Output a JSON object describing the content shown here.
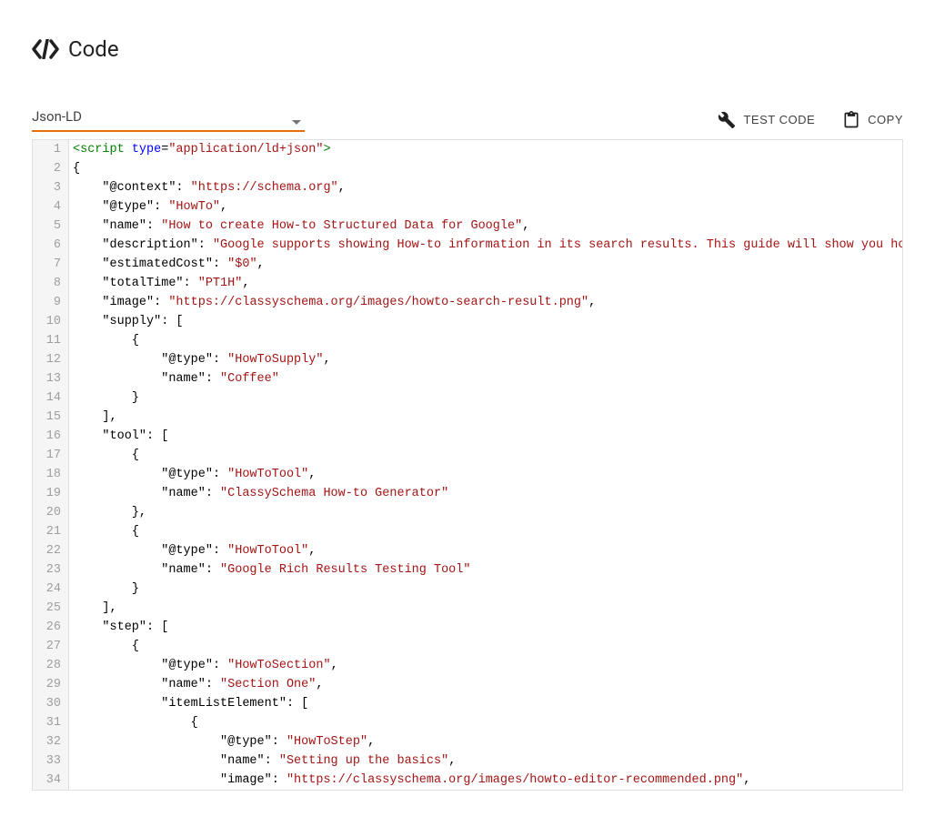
{
  "header": {
    "title": "Code"
  },
  "toolbar": {
    "dropdown_label": "Json-LD",
    "test_label": "TEST CODE",
    "copy_label": "COPY"
  },
  "editor": {
    "lines": [
      {
        "n": 1,
        "tokens": [
          [
            "t-tag",
            "<script "
          ],
          [
            "t-attr",
            "type"
          ],
          [
            "t-punct",
            "="
          ],
          [
            "t-str",
            "\"application/ld+json\""
          ],
          [
            "t-tag",
            ">"
          ]
        ]
      },
      {
        "n": 2,
        "tokens": [
          [
            "t-punct",
            "{"
          ]
        ]
      },
      {
        "n": 3,
        "tokens": [
          [
            "",
            "    "
          ],
          [
            "t-key",
            "\"@context\""
          ],
          [
            "t-punct",
            ": "
          ],
          [
            "t-str",
            "\"https://schema.org\""
          ],
          [
            "t-punct",
            ","
          ]
        ]
      },
      {
        "n": 4,
        "tokens": [
          [
            "",
            "    "
          ],
          [
            "t-key",
            "\"@type\""
          ],
          [
            "t-punct",
            ": "
          ],
          [
            "t-str",
            "\"HowTo\""
          ],
          [
            "t-punct",
            ","
          ]
        ]
      },
      {
        "n": 5,
        "tokens": [
          [
            "",
            "    "
          ],
          [
            "t-key",
            "\"name\""
          ],
          [
            "t-punct",
            ": "
          ],
          [
            "t-str",
            "\"How to create How-to Structured Data for Google\""
          ],
          [
            "t-punct",
            ","
          ]
        ]
      },
      {
        "n": 6,
        "tokens": [
          [
            "",
            "    "
          ],
          [
            "t-key",
            "\"description\""
          ],
          [
            "t-punct",
            ": "
          ],
          [
            "t-str",
            "\"Google supports showing How-to information in its search results. This guide will show you how to use "
          ]
        ]
      },
      {
        "n": 7,
        "tokens": [
          [
            "",
            "    "
          ],
          [
            "t-key",
            "\"estimatedCost\""
          ],
          [
            "t-punct",
            ": "
          ],
          [
            "t-str",
            "\"$0\""
          ],
          [
            "t-punct",
            ","
          ]
        ]
      },
      {
        "n": 8,
        "tokens": [
          [
            "",
            "    "
          ],
          [
            "t-key",
            "\"totalTime\""
          ],
          [
            "t-punct",
            ": "
          ],
          [
            "t-str",
            "\"PT1H\""
          ],
          [
            "t-punct",
            ","
          ]
        ]
      },
      {
        "n": 9,
        "tokens": [
          [
            "",
            "    "
          ],
          [
            "t-key",
            "\"image\""
          ],
          [
            "t-punct",
            ": "
          ],
          [
            "t-str",
            "\"https://classyschema.org/images/howto-search-result.png\""
          ],
          [
            "t-punct",
            ","
          ]
        ]
      },
      {
        "n": 10,
        "tokens": [
          [
            "",
            "    "
          ],
          [
            "t-key",
            "\"supply\""
          ],
          [
            "t-punct",
            ": ["
          ]
        ]
      },
      {
        "n": 11,
        "tokens": [
          [
            "",
            "        "
          ],
          [
            "t-punct",
            "{"
          ]
        ]
      },
      {
        "n": 12,
        "tokens": [
          [
            "",
            "            "
          ],
          [
            "t-key",
            "\"@type\""
          ],
          [
            "t-punct",
            ": "
          ],
          [
            "t-str",
            "\"HowToSupply\""
          ],
          [
            "t-punct",
            ","
          ]
        ]
      },
      {
        "n": 13,
        "tokens": [
          [
            "",
            "            "
          ],
          [
            "t-key",
            "\"name\""
          ],
          [
            "t-punct",
            ": "
          ],
          [
            "t-str",
            "\"Coffee\""
          ]
        ]
      },
      {
        "n": 14,
        "tokens": [
          [
            "",
            "        "
          ],
          [
            "t-punct",
            "}"
          ]
        ]
      },
      {
        "n": 15,
        "tokens": [
          [
            "",
            "    "
          ],
          [
            "t-punct",
            "],"
          ]
        ]
      },
      {
        "n": 16,
        "tokens": [
          [
            "",
            "    "
          ],
          [
            "t-key",
            "\"tool\""
          ],
          [
            "t-punct",
            ": ["
          ]
        ]
      },
      {
        "n": 17,
        "tokens": [
          [
            "",
            "        "
          ],
          [
            "t-punct",
            "{"
          ]
        ]
      },
      {
        "n": 18,
        "tokens": [
          [
            "",
            "            "
          ],
          [
            "t-key",
            "\"@type\""
          ],
          [
            "t-punct",
            ": "
          ],
          [
            "t-str",
            "\"HowToTool\""
          ],
          [
            "t-punct",
            ","
          ]
        ]
      },
      {
        "n": 19,
        "tokens": [
          [
            "",
            "            "
          ],
          [
            "t-key",
            "\"name\""
          ],
          [
            "t-punct",
            ": "
          ],
          [
            "t-str",
            "\"ClassySchema How-to Generator\""
          ]
        ]
      },
      {
        "n": 20,
        "tokens": [
          [
            "",
            "        "
          ],
          [
            "t-punct",
            "},"
          ]
        ]
      },
      {
        "n": 21,
        "tokens": [
          [
            "",
            "        "
          ],
          [
            "t-punct",
            "{"
          ]
        ]
      },
      {
        "n": 22,
        "tokens": [
          [
            "",
            "            "
          ],
          [
            "t-key",
            "\"@type\""
          ],
          [
            "t-punct",
            ": "
          ],
          [
            "t-str",
            "\"HowToTool\""
          ],
          [
            "t-punct",
            ","
          ]
        ]
      },
      {
        "n": 23,
        "tokens": [
          [
            "",
            "            "
          ],
          [
            "t-key",
            "\"name\""
          ],
          [
            "t-punct",
            ": "
          ],
          [
            "t-str",
            "\"Google Rich Results Testing Tool\""
          ]
        ]
      },
      {
        "n": 24,
        "tokens": [
          [
            "",
            "        "
          ],
          [
            "t-punct",
            "}"
          ]
        ]
      },
      {
        "n": 25,
        "tokens": [
          [
            "",
            "    "
          ],
          [
            "t-punct",
            "],"
          ]
        ]
      },
      {
        "n": 26,
        "tokens": [
          [
            "",
            "    "
          ],
          [
            "t-key",
            "\"step\""
          ],
          [
            "t-punct",
            ": ["
          ]
        ]
      },
      {
        "n": 27,
        "tokens": [
          [
            "",
            "        "
          ],
          [
            "t-punct",
            "{"
          ]
        ]
      },
      {
        "n": 28,
        "tokens": [
          [
            "",
            "            "
          ],
          [
            "t-key",
            "\"@type\""
          ],
          [
            "t-punct",
            ": "
          ],
          [
            "t-str",
            "\"HowToSection\""
          ],
          [
            "t-punct",
            ","
          ]
        ]
      },
      {
        "n": 29,
        "tokens": [
          [
            "",
            "            "
          ],
          [
            "t-key",
            "\"name\""
          ],
          [
            "t-punct",
            ": "
          ],
          [
            "t-str",
            "\"Section One\""
          ],
          [
            "t-punct",
            ","
          ]
        ]
      },
      {
        "n": 30,
        "tokens": [
          [
            "",
            "            "
          ],
          [
            "t-key",
            "\"itemListElement\""
          ],
          [
            "t-punct",
            ": ["
          ]
        ]
      },
      {
        "n": 31,
        "tokens": [
          [
            "",
            "                "
          ],
          [
            "t-punct",
            "{"
          ]
        ]
      },
      {
        "n": 32,
        "tokens": [
          [
            "",
            "                    "
          ],
          [
            "t-key",
            "\"@type\""
          ],
          [
            "t-punct",
            ": "
          ],
          [
            "t-str",
            "\"HowToStep\""
          ],
          [
            "t-punct",
            ","
          ]
        ]
      },
      {
        "n": 33,
        "tokens": [
          [
            "",
            "                    "
          ],
          [
            "t-key",
            "\"name\""
          ],
          [
            "t-punct",
            ": "
          ],
          [
            "t-str",
            "\"Setting up the basics\""
          ],
          [
            "t-punct",
            ","
          ]
        ]
      },
      {
        "n": 34,
        "tokens": [
          [
            "",
            "                    "
          ],
          [
            "t-key",
            "\"image\""
          ],
          [
            "t-punct",
            ": "
          ],
          [
            "t-str",
            "\"https://classyschema.org/images/howto-editor-recommended.png\""
          ],
          [
            "t-punct",
            ","
          ]
        ]
      }
    ]
  }
}
